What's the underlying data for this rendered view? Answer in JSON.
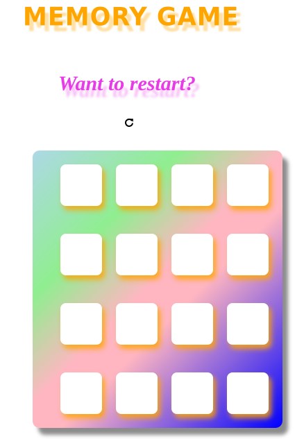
{
  "header": {
    "title": "MEMORY GAME"
  },
  "restart": {
    "heading": "Want to restart?",
    "icon": "refresh-icon"
  },
  "board": {
    "rows": 4,
    "columns": 4,
    "cards": [
      {
        "face": "hidden"
      },
      {
        "face": "hidden"
      },
      {
        "face": "hidden"
      },
      {
        "face": "hidden"
      },
      {
        "face": "hidden"
      },
      {
        "face": "hidden"
      },
      {
        "face": "hidden"
      },
      {
        "face": "hidden"
      },
      {
        "face": "hidden"
      },
      {
        "face": "hidden"
      },
      {
        "face": "hidden"
      },
      {
        "face": "hidden"
      },
      {
        "face": "hidden"
      },
      {
        "face": "hidden"
      },
      {
        "face": "hidden"
      },
      {
        "face": "hidden"
      }
    ],
    "gradient_colors": [
      "#add8e6",
      "#90ee90",
      "#ffb6c1",
      "#0000ff"
    ]
  },
  "colors": {
    "title": "#ffa500",
    "restart_heading": "#e63be6",
    "card_glow": "#ffa500",
    "card_face": "#ffffff"
  }
}
